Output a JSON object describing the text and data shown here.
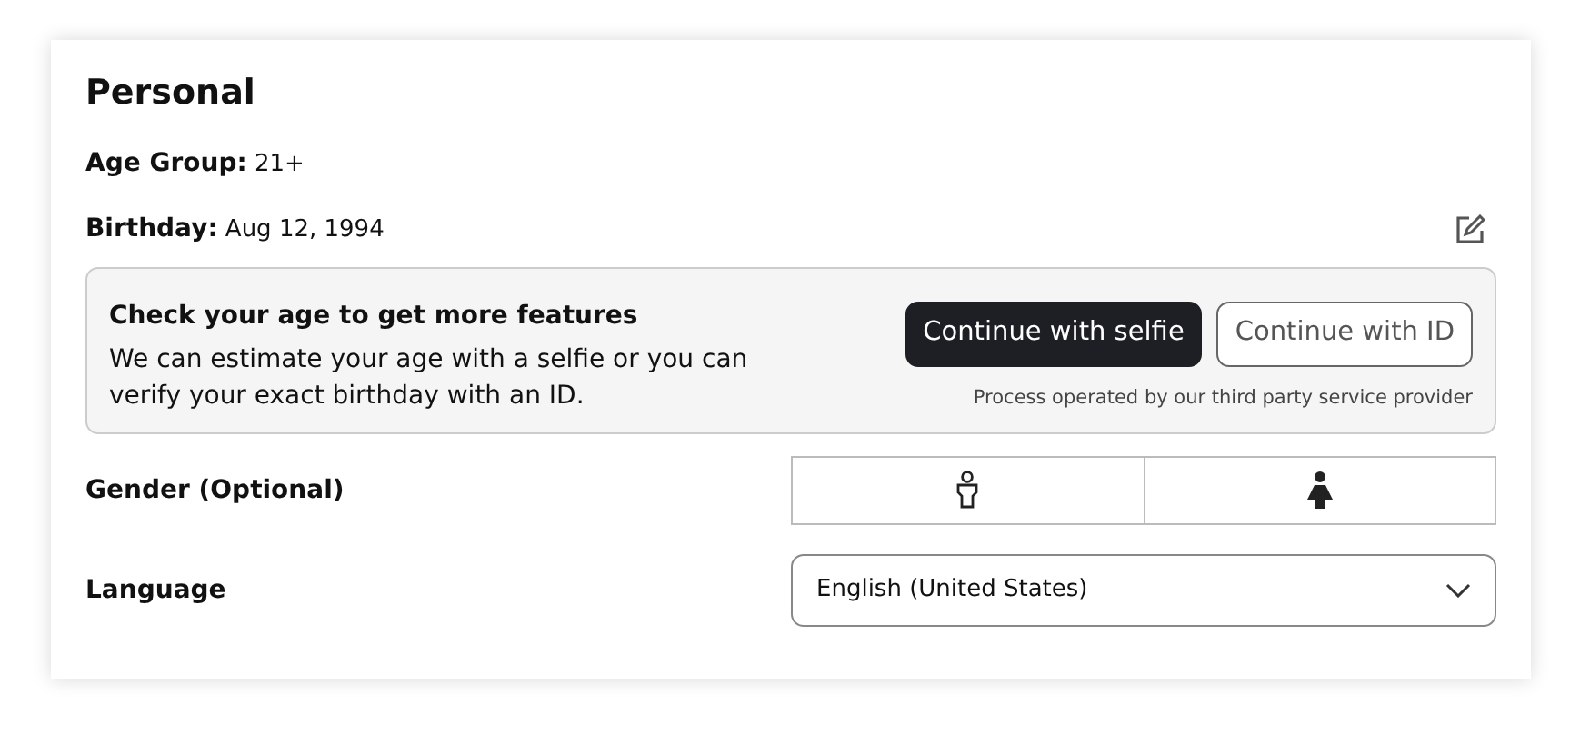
{
  "section": {
    "title": "Personal"
  },
  "fields": [
    {
      "label": "Age Group:",
      "value": "21+",
      "editable": false
    },
    {
      "label": "Birthday:",
      "value": "Aug 12, 1994",
      "editable": true
    }
  ],
  "age_check": {
    "title": "Check your age to get more features",
    "text": "We can estimate your age with a selfie or you can verify your exact birthday with an ID.",
    "buttons": [
      {
        "label": "Continue with selfie",
        "kind": "primary"
      },
      {
        "label": "Continue with ID",
        "kind": "outline"
      }
    ],
    "note": "Process operated by our third party service provider"
  },
  "gender": {
    "label": "Gender (Optional)",
    "options": [
      {
        "kind": "male",
        "selected": false
      },
      {
        "kind": "female",
        "selected": false
      }
    ]
  },
  "language": {
    "label": "Language",
    "value": "English (United States)"
  }
}
